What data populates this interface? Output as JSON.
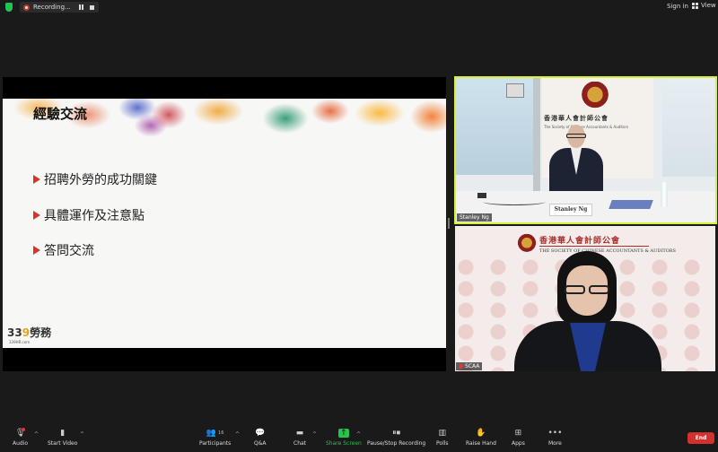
{
  "topbar": {
    "recording_label": "Recording...",
    "sign_in": "Sign in",
    "view": "View"
  },
  "slide": {
    "title": "經驗交流",
    "bullets": [
      "招聘外勞的成功關鍵",
      "具體運作及注意點",
      "答問交流"
    ],
    "logo_main_a": "33",
    "logo_main_b": "9",
    "logo_main_c": "勞務",
    "logo_sub": "339HR.com"
  },
  "tiles": [
    {
      "name": "Stanley Ng",
      "nameplate": "Stanley Ng",
      "society_zh": "香港華人會計師公會",
      "society_en": "The Society of Chinese Accountants & Auditors"
    },
    {
      "name": "SCAA",
      "society_zh": "香港華人會計師公會",
      "society_en": "THE SOCIETY OF CHINESE ACCOUNTANTS & AUDITORS"
    }
  ],
  "toolbar": {
    "audio": "Audio",
    "start_video": "Start Video",
    "participants": "Participants",
    "participants_count": "16",
    "qa": "Q&A",
    "chat": "Chat",
    "share_screen": "Share Screen",
    "pause_stop_recording": "Pause/Stop Recording",
    "polls": "Polls",
    "raise_hand": "Raise Hand",
    "apps": "Apps",
    "more": "More",
    "end": "End"
  },
  "colors": {
    "active_speaker_border": "#d9ef3a",
    "share_green": "#27c24c",
    "end_red": "#d3312d",
    "bullet_red": "#d9342b"
  }
}
